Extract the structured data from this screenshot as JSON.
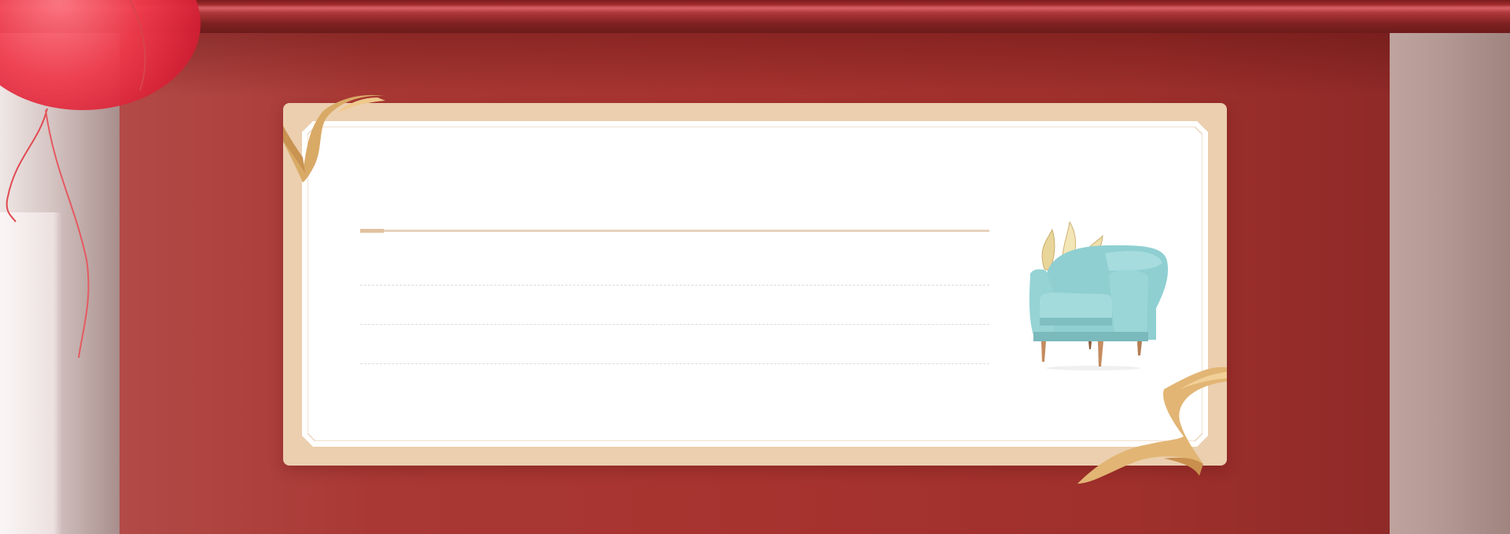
{
  "scene": {
    "title": "",
    "rows": [
      {
        "text": ""
      },
      {
        "text": ""
      },
      {
        "text": ""
      }
    ]
  },
  "colors": {
    "wall": "#a7332f",
    "card_frame": "#ebcfaf",
    "card_panel": "#ffffff",
    "accent_line": "#e7d2bd",
    "balloon": "#ef3b4c"
  },
  "icons": {
    "balloon": "balloon-icon",
    "chair": "armchair-icon",
    "ribbon": "ribbon-icon"
  }
}
